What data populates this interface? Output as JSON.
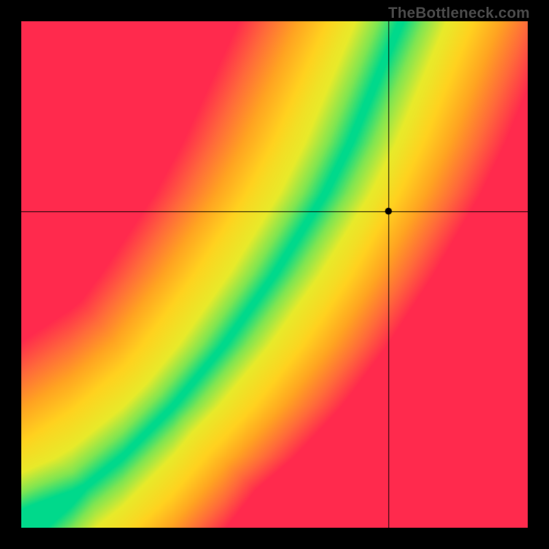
{
  "watermark": "TheBottleneck.com",
  "chart_data": {
    "type": "heatmap",
    "title": "",
    "xlabel": "",
    "ylabel": "",
    "xlim": [
      0,
      1
    ],
    "ylim": [
      0,
      1
    ],
    "crosshair": {
      "x": 0.725,
      "y": 0.625
    },
    "marker": {
      "x": 0.725,
      "y": 0.625
    },
    "optimal_curve_description": "Green optimal band runs diagonally from bottom-left to top-right with a slight S-curve, indicating balanced configurations. Distance from the band transitions through yellow/orange to red indicating increasing bottleneck.",
    "optimal_curve_samples": [
      {
        "x": 0.0,
        "y": 0.0
      },
      {
        "x": 0.1,
        "y": 0.06
      },
      {
        "x": 0.2,
        "y": 0.14
      },
      {
        "x": 0.3,
        "y": 0.24
      },
      {
        "x": 0.4,
        "y": 0.36
      },
      {
        "x": 0.5,
        "y": 0.5
      },
      {
        "x": 0.6,
        "y": 0.66
      },
      {
        "x": 0.65,
        "y": 0.76
      },
      {
        "x": 0.7,
        "y": 0.88
      },
      {
        "x": 0.75,
        "y": 1.0
      }
    ],
    "color_scale": [
      {
        "t": 0.0,
        "color": "#00d98b"
      },
      {
        "t": 0.1,
        "color": "#7ee552"
      },
      {
        "t": 0.22,
        "color": "#e8ea2a"
      },
      {
        "t": 0.4,
        "color": "#ffd21f"
      },
      {
        "t": 0.6,
        "color": "#ffa421"
      },
      {
        "t": 0.8,
        "color": "#ff6a3a"
      },
      {
        "t": 1.0,
        "color": "#ff2a4d"
      }
    ]
  }
}
